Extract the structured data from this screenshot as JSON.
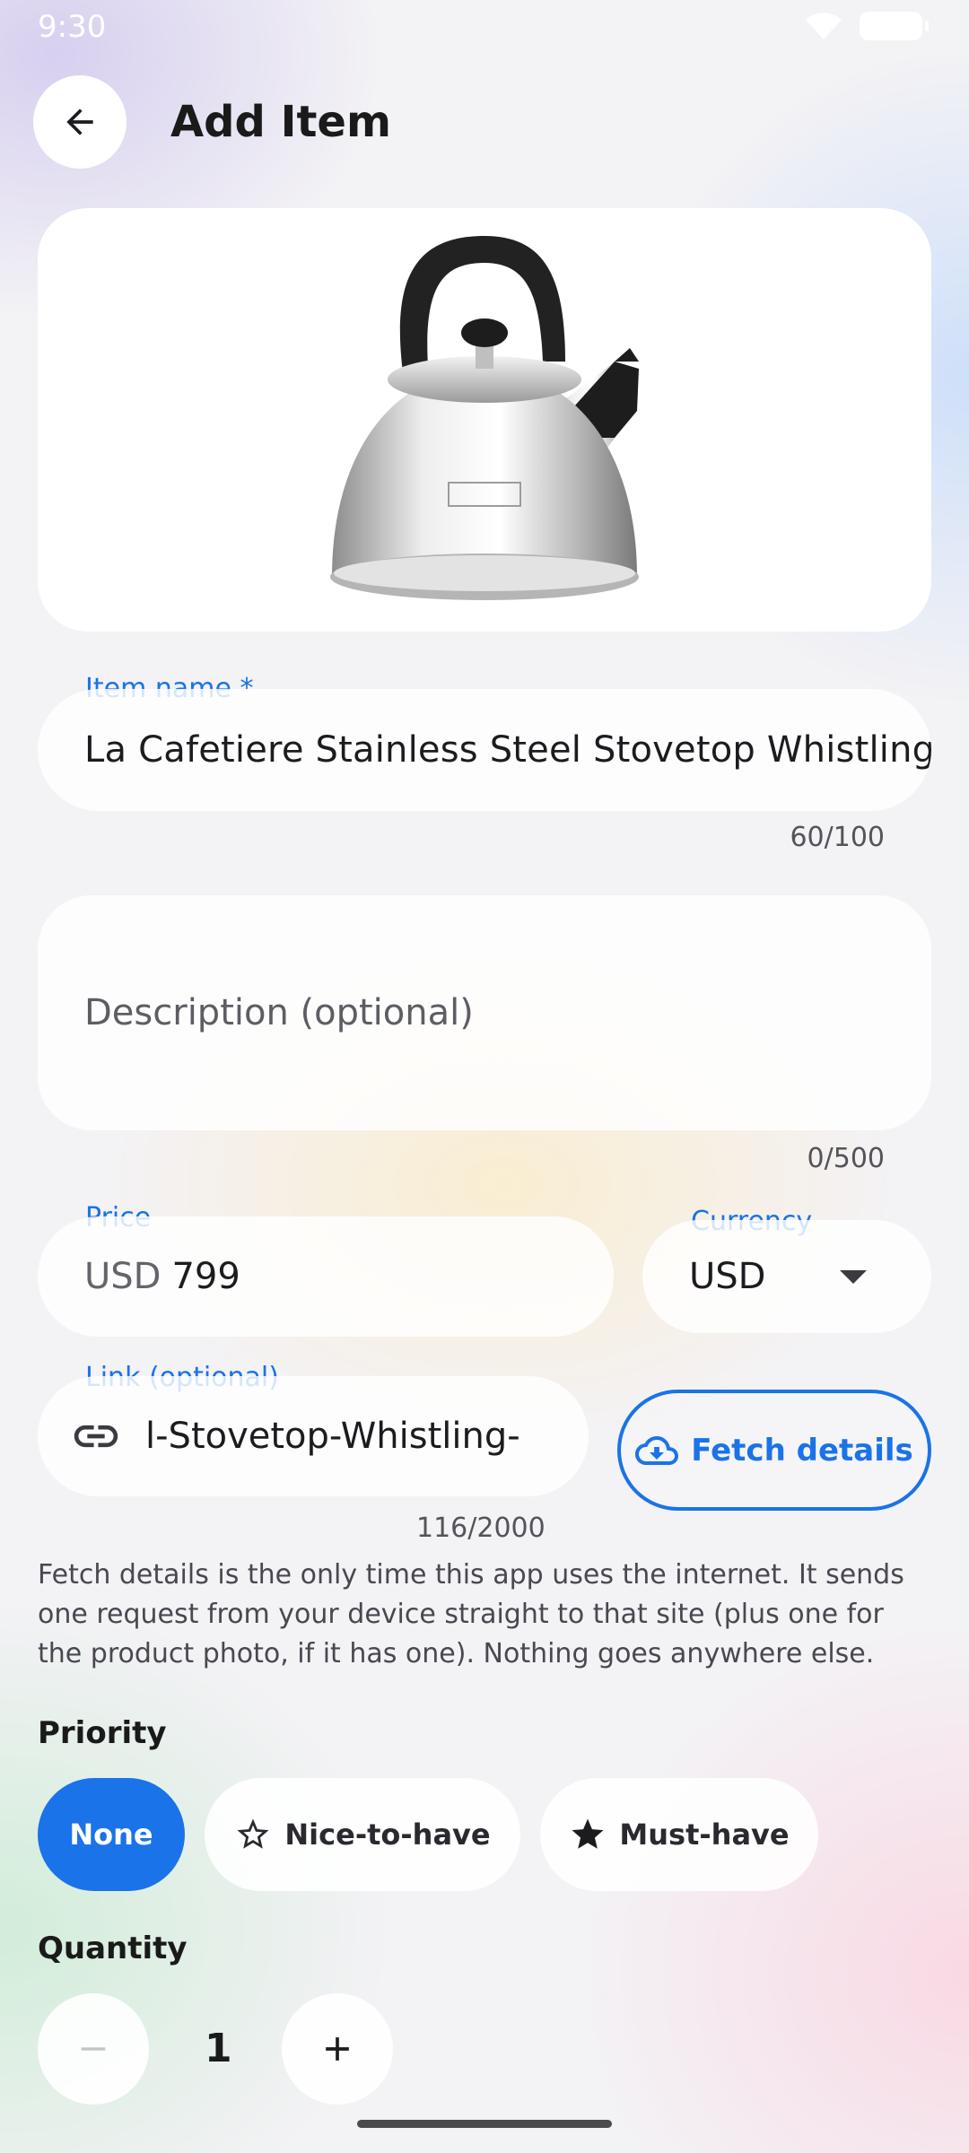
{
  "status_bar": {
    "time": "9:30"
  },
  "header": {
    "title": "Add Item"
  },
  "item_name": {
    "label": "Item name *",
    "value": "La Cafetiere Stainless Steel Stovetop Whistling Kettle",
    "counter": "60/100"
  },
  "description": {
    "placeholder": "Description (optional)",
    "counter": "0/500"
  },
  "price": {
    "label": "Price",
    "prefix": "USD",
    "value": "799"
  },
  "currency": {
    "label": "Currency",
    "value": "USD"
  },
  "link": {
    "label": "Link (optional)",
    "visible_value": "l-Stovetop-Whistling-",
    "counter": "116/2000"
  },
  "fetch_button": {
    "label": "Fetch details",
    "icon": "cloud-download-icon"
  },
  "note": "Fetch details is the only time this app uses the internet. It sends one request from your device straight to that site (plus one for the product photo, if it has one). Nothing goes anywhere else.",
  "priority": {
    "label": "Priority",
    "options": [
      {
        "label": "None",
        "selected": true
      },
      {
        "label": "Nice-to-have",
        "icon": "star-outline-icon",
        "selected": false
      },
      {
        "label": "Must-have",
        "icon": "star-filled-icon",
        "selected": false
      }
    ]
  },
  "quantity": {
    "label": "Quantity",
    "value": "1"
  },
  "colors": {
    "accent": "#1a73e8"
  }
}
